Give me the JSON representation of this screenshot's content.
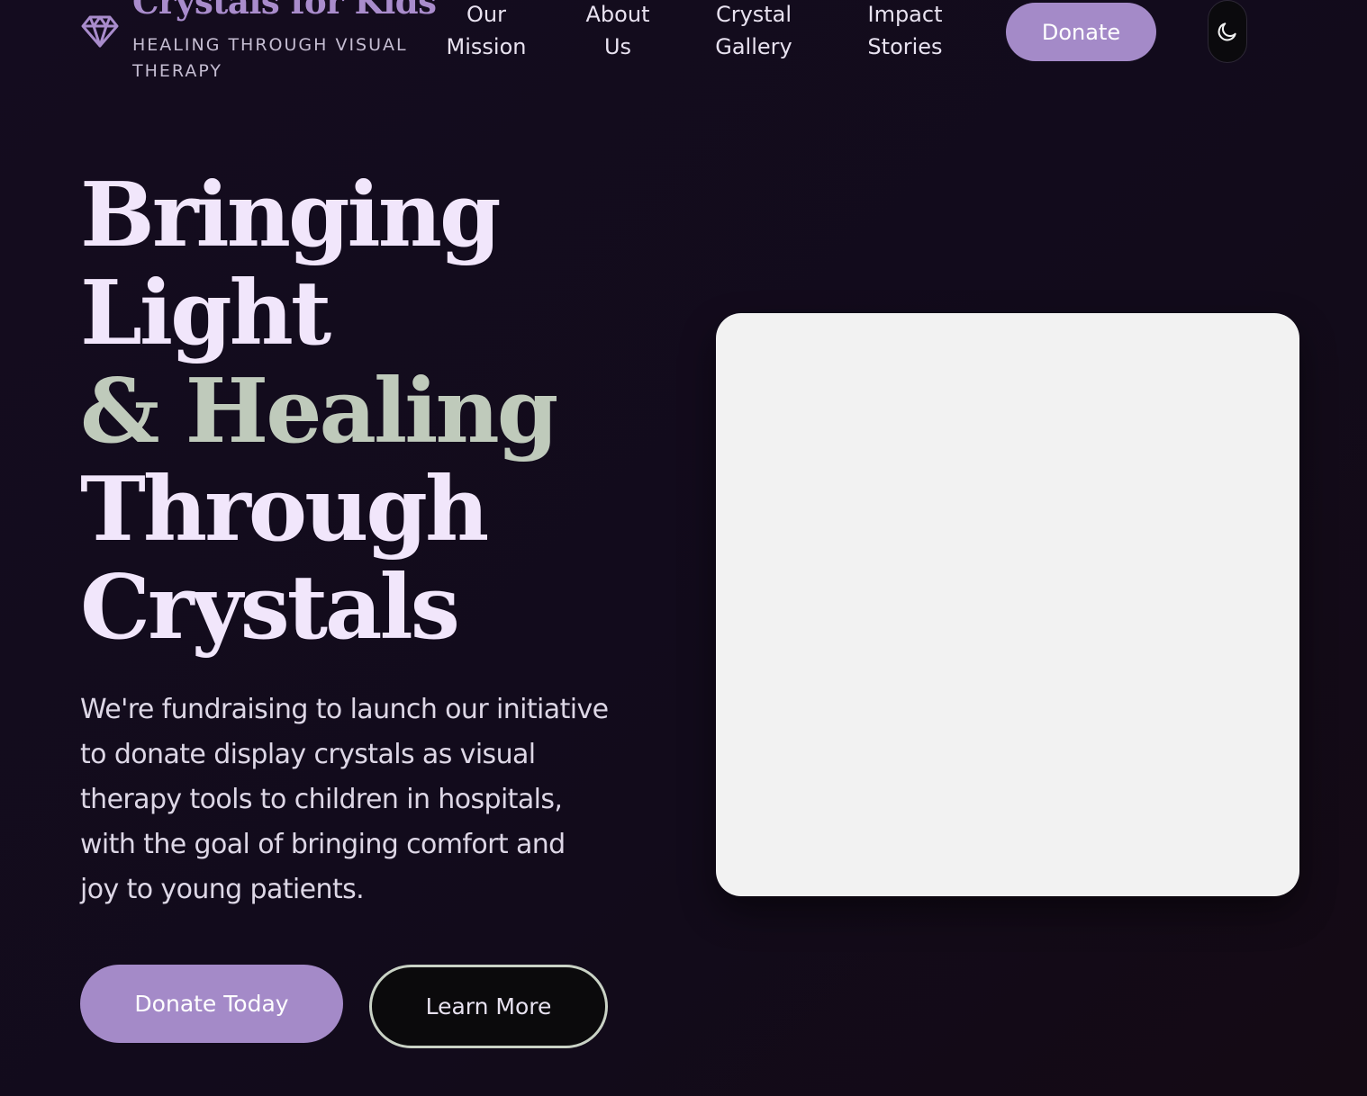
{
  "header": {
    "brand_name": "Crystals for Kids",
    "tagline": "HEALING THROUGH VISUAL THERAPY",
    "logo_icon": "gem-icon",
    "nav": [
      {
        "label": "Our Mission"
      },
      {
        "label": "About Us"
      },
      {
        "label": "Crystal Gallery"
      },
      {
        "label": "Impact Stories"
      }
    ],
    "donate_label": "Donate",
    "theme_toggle_icon": "moon-icon"
  },
  "hero": {
    "title_lines": [
      "Bringing",
      "Light",
      "& Healing",
      "Through",
      "Crystals"
    ],
    "description": "We're fundraising to launch our initiative to donate display crystals as visual therapy tools to children in hospitals, with the goal of bringing comfort and joy to young patients.",
    "primary_button": "Donate Today",
    "secondary_button": "Learn More"
  },
  "colors": {
    "background": "#130c1c",
    "brand_purple": "#a48ac8",
    "title_text": "#f1e6fb",
    "accent_sage": "#bfcabb",
    "image_placeholder": "#f2f2f2"
  }
}
